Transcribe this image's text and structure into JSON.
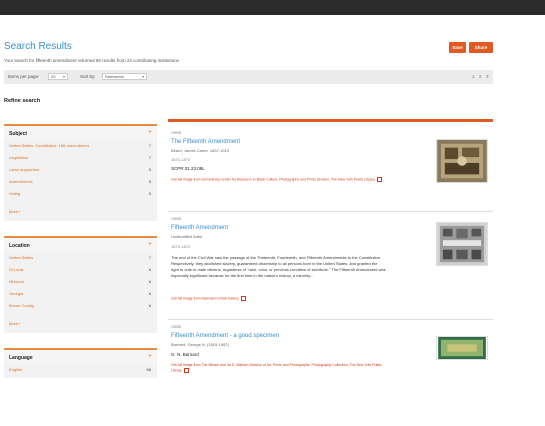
{
  "header": {
    "title": "Search Results",
    "subtitle": "Your search for fifteenth amendment returned 56 results from 23 contributing institutions"
  },
  "actions": {
    "save": "Save",
    "share": "Share"
  },
  "controls": {
    "items_per_page_label": "Items per page:",
    "items_per_page_value": "20",
    "sort_by_label": "Sort by:",
    "sort_by_value": "Relevance",
    "pages": [
      "1",
      "2",
      "3"
    ]
  },
  "refine": {
    "title": "Refine search"
  },
  "facets": [
    {
      "title": "Subject",
      "toggle": "+",
      "items": [
        {
          "label": "United States. Constitution. 15th Amendment",
          "count": "7"
        },
        {
          "label": "Legislators",
          "count": "7"
        },
        {
          "label": "Labor supporters",
          "count": "5"
        },
        {
          "label": "Amendments",
          "count": "5"
        },
        {
          "label": "Voting",
          "count": "5"
        }
      ],
      "more": "More+"
    },
    {
      "title": "Location",
      "toggle": "+",
      "items": [
        {
          "label": "United States",
          "count": "7"
        },
        {
          "label": "St Louis",
          "count": "6"
        },
        {
          "label": "Missouri",
          "count": "6"
        },
        {
          "label": "Georgia",
          "count": "6"
        },
        {
          "label": "Brown County",
          "count": "6"
        }
      ],
      "more": "More+"
    },
    {
      "title": "Language",
      "toggle": "+",
      "items": [
        {
          "label": "English",
          "count": "56"
        }
      ],
      "more": ""
    }
  ],
  "results": [
    {
      "date": "1900S",
      "title": "The Fifteenth Amendment",
      "creator": "Beard, James Carter, 1837-1913",
      "years": "1870-1870",
      "text": "SCPR 01.23.09L",
      "description": "",
      "link": "Get full image from Schomburg Center for Research in Black Culture, Photographs and Prints Division, The New York Public Library"
    },
    {
      "date": "1900S",
      "title": "Fifteenth Amendment",
      "creator": "Unidentified Artist",
      "years": "1870-1870",
      "text": "",
      "description": "The end of the Civil War saw the passage of the Thirteenth, Fourteenth, and Fifteenth Amendments to the Constitution. Respectively, they abolished slavery, guaranteed citizenship to all persons born in the United States, and granted the right to vote to male citizens, regardless of \"race, color, or previous condition of servitude.\" The Fifteenth Amendment was especially significant because for the first time in the nation's history, a minority...",
      "link": "Get full image from National Portrait Gallery"
    },
    {
      "date": "1900S",
      "title": "Fifteenth Amendment - a good specimen",
      "creator": "Barnard, George N. (1819-1902)",
      "years": "",
      "text": "G. N. Barnard",
      "description": "",
      "link": "Get full image from The Miriam and Ira D. Wallach Division of Art, Prints and Photographs: Photography Collection. The New York Public Library"
    }
  ],
  "colors": {
    "accent": "#e05a24",
    "link": "#3a8fc7",
    "facet_link": "#e07020"
  }
}
